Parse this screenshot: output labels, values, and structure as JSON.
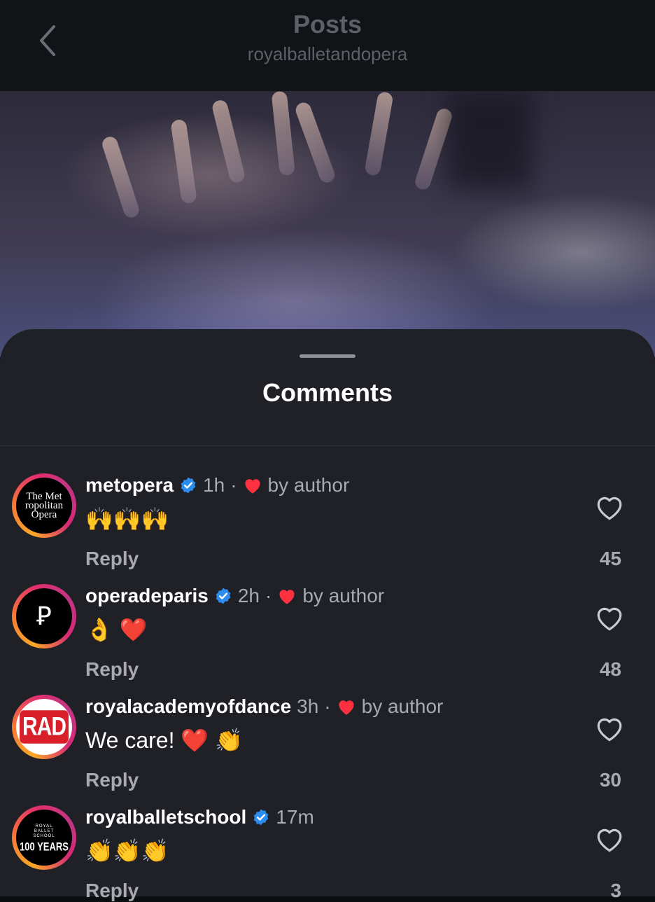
{
  "header": {
    "title": "Posts",
    "subtitle": "royalballetandopera",
    "back_icon": "chevron-left-icon"
  },
  "sheet": {
    "title": "Comments"
  },
  "colors": {
    "background": "#202127",
    "verified": "#2d8cf0",
    "heart_red": "#ff3040",
    "muted_text": "#a8aab0"
  },
  "comments": [
    {
      "username": "metopera",
      "verified": true,
      "time": "1h",
      "separator": "·",
      "liked_by_author": true,
      "by_author_label": "by author",
      "text": "🙌🙌🙌",
      "reply_label": "Reply",
      "likes": "45",
      "avatar_text": [
        "The Met",
        "ropolitan",
        "Opera"
      ]
    },
    {
      "username": "operadeparis",
      "verified": true,
      "time": "2h",
      "separator": "·",
      "liked_by_author": true,
      "by_author_label": "by author",
      "text": "👌 ❤️",
      "reply_label": "Reply",
      "likes": "48",
      "avatar_text": "Ꝑ"
    },
    {
      "username": "royalacademyofdance",
      "verified": false,
      "time": "3h",
      "separator": "·",
      "liked_by_author": true,
      "by_author_label": "by author",
      "text": "We care! ❤️ 👏",
      "reply_label": "Reply",
      "likes": "30",
      "avatar_text": "RAD"
    },
    {
      "username": "royalballetschool",
      "verified": true,
      "time": "17m",
      "liked_by_author": false,
      "text": "👏👏👏",
      "reply_label": "Reply",
      "likes": "3",
      "avatar_text": [
        "ROYAL",
        "BALLET",
        "SCHOOL",
        "100 YEARS"
      ]
    }
  ]
}
